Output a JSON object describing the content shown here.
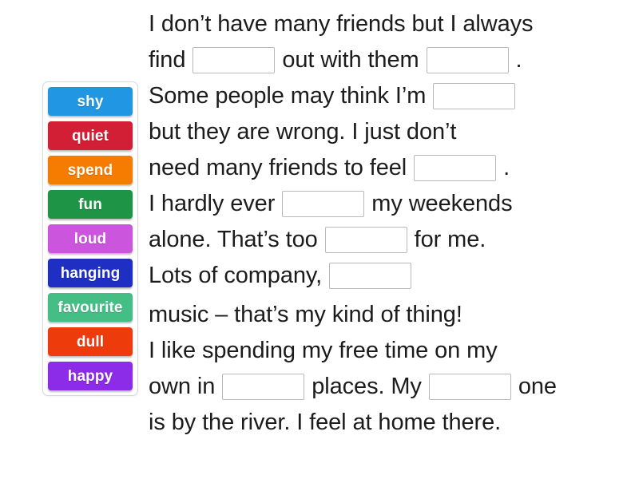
{
  "word_bank": {
    "name": "word-bank",
    "tiles": [
      {
        "label": "shy",
        "color": "#2196E3",
        "text_color": "#ffffff"
      },
      {
        "label": "quiet",
        "color": "#D21F35",
        "text_color": "#ffffff"
      },
      {
        "label": "spend",
        "color": "#F57C00",
        "text_color": "#ffffff"
      },
      {
        "label": "fun",
        "color": "#1E9447",
        "text_color": "#ffffff"
      },
      {
        "label": "loud",
        "color": "#CB55DC",
        "text_color": "#ffffff"
      },
      {
        "label": "hanging",
        "color": "#1F2FC4",
        "text_color": "#ffffff"
      },
      {
        "label": "favourite",
        "color": "#45BE86",
        "text_color": "#ffffff"
      },
      {
        "label": "dull",
        "color": "#EE3B0C",
        "text_color": "#ffffff"
      },
      {
        "label": "happy",
        "color": "#8C2BE8",
        "text_color": "#ffffff"
      }
    ]
  },
  "passage": {
    "lines": [
      {
        "segments": [
          {
            "type": "text",
            "value": "I don’t have many friends but I always"
          }
        ]
      },
      {
        "segments": [
          {
            "type": "text",
            "value": "find"
          },
          {
            "type": "blank",
            "value": ""
          },
          {
            "type": "text",
            "value": "out with them"
          },
          {
            "type": "blank",
            "value": ""
          },
          {
            "type": "text",
            "value": "."
          }
        ]
      },
      {
        "segments": [
          {
            "type": "text",
            "value": "Some people may think I’m"
          },
          {
            "type": "blank",
            "value": ""
          }
        ]
      },
      {
        "segments": [
          {
            "type": "text",
            "value": "but they are wrong. I just don’t"
          }
        ]
      },
      {
        "segments": [
          {
            "type": "text",
            "value": "need many friends to feel"
          },
          {
            "type": "blank",
            "value": ""
          },
          {
            "type": "text",
            "value": "."
          }
        ]
      },
      {
        "segments": [
          {
            "type": "text",
            "value": "I hardly ever"
          },
          {
            "type": "blank",
            "value": ""
          },
          {
            "type": "text",
            "value": "my weekends"
          }
        ]
      },
      {
        "segments": [
          {
            "type": "text",
            "value": "alone. That’s too"
          },
          {
            "type": "blank",
            "value": ""
          },
          {
            "type": "text",
            "value": "for me."
          }
        ]
      },
      {
        "segments": [
          {
            "type": "text",
            "value": "Lots of company,"
          },
          {
            "type": "blank",
            "value": ""
          }
        ]
      },
      {
        "segments": [
          {
            "type": "text",
            "value": "music – that’s my kind of thing!"
          }
        ]
      },
      {
        "segments": [
          {
            "type": "text",
            "value": "I like spending my free time on my"
          }
        ]
      },
      {
        "segments": [
          {
            "type": "text",
            "value": "own in"
          },
          {
            "type": "blank",
            "value": ""
          },
          {
            "type": "text",
            "value": "places. My"
          },
          {
            "type": "blank",
            "value": ""
          },
          {
            "type": "text",
            "value": "one"
          }
        ]
      },
      {
        "segments": [
          {
            "type": "text",
            "value": "is by the river. I feel at home there."
          }
        ]
      }
    ]
  },
  "colors": {
    "page_background": "#ffffff",
    "text": "#1c1c1c",
    "blank_border": "#b9b9b9",
    "bank_border": "#d8d8d8"
  }
}
